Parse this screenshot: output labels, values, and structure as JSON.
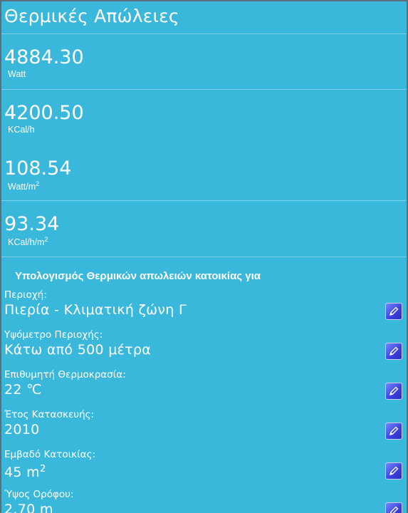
{
  "header": {
    "title": "Θερμικές Απώλειες"
  },
  "stats": [
    {
      "value": "4884.30",
      "unit": "Watt"
    },
    {
      "value": "4200.50",
      "unit": "KCal/h"
    },
    {
      "value": "108.54",
      "unit_base": "Watt/m",
      "unit_sup": "2"
    },
    {
      "value": "93.34",
      "unit_base": "KCal/h/m",
      "unit_sup": "2"
    }
  ],
  "section": {
    "title": "Υπολογισμός Θερμικών απωλειών κατοικίας για"
  },
  "fields": [
    {
      "label": "Περιοχή:",
      "value": "Πιερία - Κλιματική ζώνη Γ"
    },
    {
      "label": "Υψόμετρο Περιοχής:",
      "value": "Κάτω από 500 μέτρα"
    },
    {
      "label": "Επιθυμητή Θερμοκρασία:",
      "value": "22 ℃"
    },
    {
      "label": "Έτος Κατασκευής:",
      "value": "2010"
    },
    {
      "label": "Εμβαδό Κατοικίας:",
      "value_base": "45 m",
      "value_sup": "2"
    },
    {
      "label": "Ύψος Ορόφου:",
      "value": "2.70 m"
    }
  ],
  "icons": {
    "edit": "pencil-icon"
  },
  "colors": {
    "background": "#39b8dc",
    "separator": "#7fd0ea",
    "edit_button": "#3a3fe0"
  }
}
